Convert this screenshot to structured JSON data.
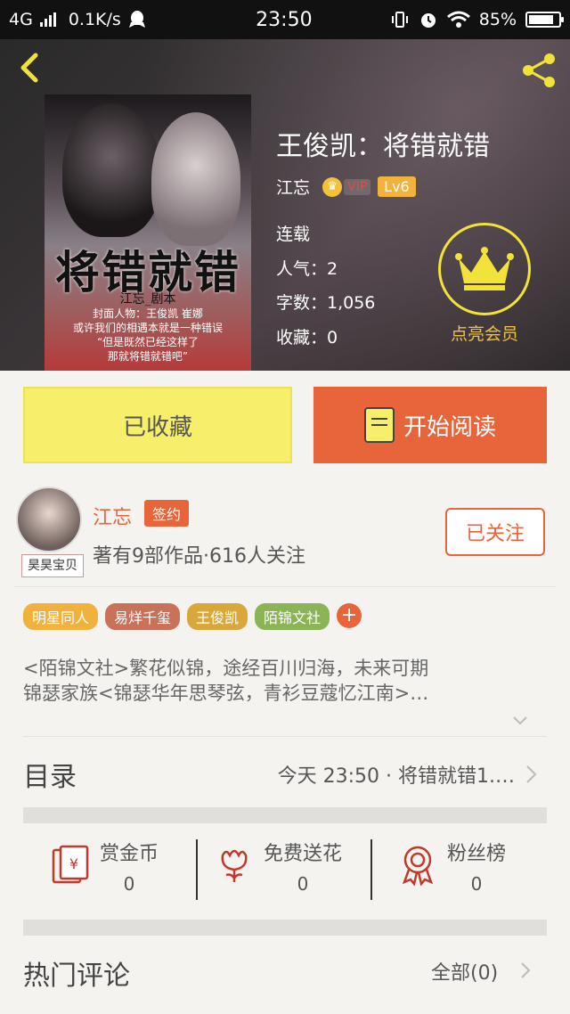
{
  "status_bar": {
    "network": "4G",
    "speed": "0.1K/s",
    "time": "23:50",
    "battery": "85%",
    "battery_level": 0.85
  },
  "book": {
    "title": "王俊凯：将错就错",
    "cover_title": "将错就错",
    "cover_credit": "江忘_剧本",
    "cover_lines": [
      "封面人物：王俊凯 崔娜",
      "或许我们的相遇本就是一种错误",
      "“但是既然已经这样了",
      "那就将错就错吧”"
    ],
    "author": "江忘",
    "vip_label": "VIP",
    "level": "Lv6",
    "status": "连载",
    "popularity": "人气：2",
    "word_count": "字数：1,056",
    "collections": "收藏：0",
    "vip_member_label": "点亮会员"
  },
  "actions": {
    "collected": "已收藏",
    "start_reading": "开始阅读"
  },
  "author_card": {
    "name": "江忘",
    "sign_badge": "签约",
    "avatar_tag": "昊昊宝贝",
    "stats": "著有9部作品·616人关注",
    "follow": "已关注"
  },
  "tags": [
    {
      "label": "明星同人",
      "color": "#f0b23c"
    },
    {
      "label": "易烊千玺",
      "color": "#c9725a"
    },
    {
      "label": "王俊凯",
      "color": "#d9a83a"
    },
    {
      "label": "陌锦文社",
      "color": "#8cb356"
    }
  ],
  "description": {
    "line1": "<陌锦文社>繁花似锦，途经百川归海，未来可期",
    "line2": "锦瑟家族<锦瑟华年思琴弦，青衫豆蔻忆江南>…"
  },
  "toc": {
    "title": "目录",
    "latest": "今天 23:50 · 将错就错1.…"
  },
  "stats": [
    {
      "label": "赏金币",
      "value": "0",
      "icon": "coin-envelope-icon"
    },
    {
      "label": "免费送花",
      "value": "0",
      "icon": "flower-icon"
    },
    {
      "label": "粉丝榜",
      "value": "0",
      "icon": "medal-icon"
    }
  ],
  "comments": {
    "title": "热门评论",
    "all": "全部(0)"
  },
  "colors": {
    "accent": "#e8643a",
    "yellow": "#f7ef6a",
    "gold": "#f2e23a"
  }
}
